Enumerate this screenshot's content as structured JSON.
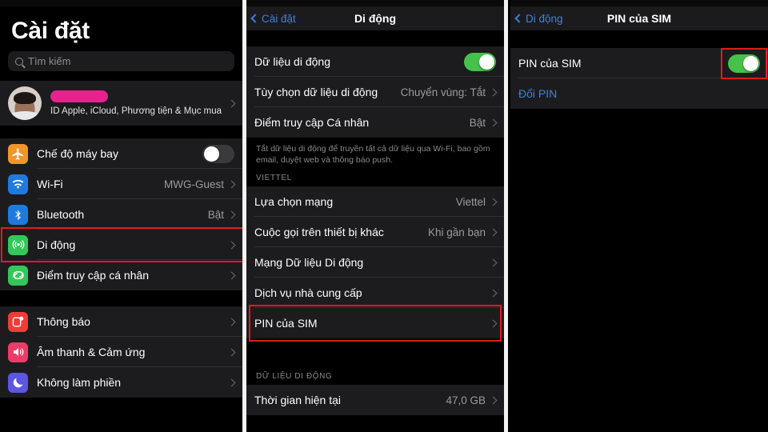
{
  "panels": {
    "left": {
      "statusbar": {
        "left": "",
        "mid": "",
        "right": ""
      },
      "title": "Cài đặt",
      "search": {
        "placeholder": "Tìm kiếm",
        "icon": "search-icon"
      },
      "account": {
        "name_redacted": "",
        "subtitle": "ID Apple, iCloud, Phương tiện & Mục mua",
        "avatar_alt": "profile-photo"
      },
      "group1": [
        {
          "icon": "airplane-icon",
          "icon_color": "#f0962a",
          "label": "Chế độ máy bay",
          "type": "toggle",
          "toggle_on": false
        },
        {
          "icon": "wifi-icon",
          "icon_color": "#1f7ae0",
          "label": "Wi-Fi",
          "type": "value",
          "value": "MWG-Guest"
        },
        {
          "icon": "bluetooth-icon",
          "icon_color": "#1f7ae0",
          "label": "Bluetooth",
          "type": "value",
          "value": "Bật"
        },
        {
          "icon": "cellular-icon",
          "icon_color": "#34c759",
          "label": "Di động",
          "type": "chevron",
          "value": "",
          "highlighted": true
        },
        {
          "icon": "hotspot-icon",
          "icon_color": "#34c759",
          "label": "Điểm truy cập cá nhân",
          "type": "chevron",
          "value": ""
        }
      ],
      "group2": [
        {
          "icon": "notifications-icon",
          "icon_color": "#f03c37",
          "label": "Thông báo",
          "type": "chevron",
          "value": ""
        },
        {
          "icon": "sounds-icon",
          "icon_color": "#ef3b68",
          "label": "Âm thanh & Cảm ứng",
          "type": "chevron",
          "value": ""
        },
        {
          "icon": "do-not-disturb-icon",
          "icon_color": "#5c56e0",
          "label": "Không làm phiền",
          "type": "chevron",
          "value": ""
        }
      ]
    },
    "middle": {
      "statusbar": {
        "left": "",
        "mid": "",
        "right": ""
      },
      "back_label": "Cài đặt",
      "title": "Di động",
      "group1": [
        {
          "label": "Dữ liệu di động",
          "type": "toggle",
          "toggle_on": true
        },
        {
          "label": "Tùy chọn dữ liệu di động",
          "type": "value",
          "value": "Chuyển vùng: Tắt"
        },
        {
          "label": "Điểm truy cập Cá nhân",
          "type": "value",
          "value": "Bật"
        }
      ],
      "footnote": "Tắt dữ liệu di động để truyền tất cả dữ liệu qua Wi-Fi, bao gồm email, duyệt web và thông báo push.",
      "section_carrier": "VIETTEL",
      "group2": [
        {
          "label": "Lựa chọn mạng",
          "type": "value",
          "value": "Viettel"
        },
        {
          "label": "Cuộc gọi trên thiết bị khác",
          "type": "value",
          "value": "Khi gần bạn"
        },
        {
          "label": "Mạng Dữ liệu Di động",
          "type": "chevron",
          "value": ""
        },
        {
          "label": "Dịch vụ nhà cung cấp",
          "type": "chevron",
          "value": ""
        },
        {
          "label": "PIN của SIM",
          "type": "chevron",
          "value": "",
          "highlighted": true
        }
      ],
      "section_data": "DỮ LIỆU DI ĐỘNG",
      "group3": [
        {
          "label": "Thời gian hiện tại",
          "type": "value",
          "value": "47,0 GB"
        }
      ]
    },
    "right": {
      "statusbar": {
        "left": "",
        "mid": "",
        "right": ""
      },
      "back_label": "Di động",
      "title": "PIN của SIM",
      "group1": [
        {
          "label": "PIN của SIM",
          "type": "toggle",
          "toggle_on": true,
          "highlighted": true
        },
        {
          "label": "Đổi PIN",
          "type": "link"
        }
      ]
    }
  },
  "colors": {
    "accent_blue": "#3f7fe0",
    "toggle_on_green": "#46c24a",
    "highlight_red": "#e01b1b",
    "redaction_magenta": "#e8218c",
    "cell_bg": "#1c1c1e",
    "page_bg": "#000000"
  }
}
